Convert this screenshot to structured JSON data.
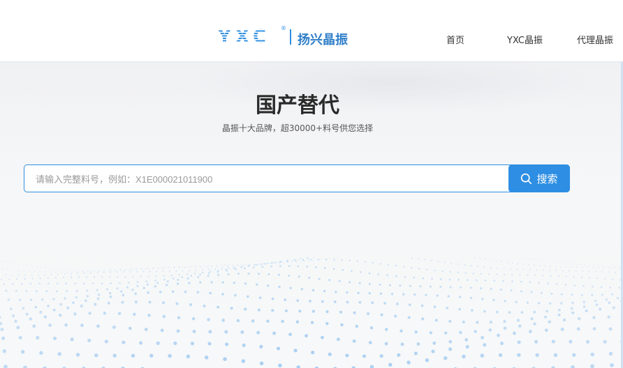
{
  "header": {
    "logo_mark": "YXC",
    "logo_reg": "®",
    "logo_cn": "扬兴晶振",
    "nav": [
      "首页",
      "YXC晶振",
      "代理晶振"
    ]
  },
  "hero": {
    "title": "国产替代",
    "subtitle": "晶振十大品牌，超30000+料号供您选择"
  },
  "search": {
    "placeholder": "请输入完整料号，例如：X1E000021011900",
    "button_label": "搜索",
    "icon": "search-icon"
  },
  "colors": {
    "accent": "#2d8ee3",
    "logo_blue": "#2f8fe0",
    "dots": "#9cc8f0"
  }
}
